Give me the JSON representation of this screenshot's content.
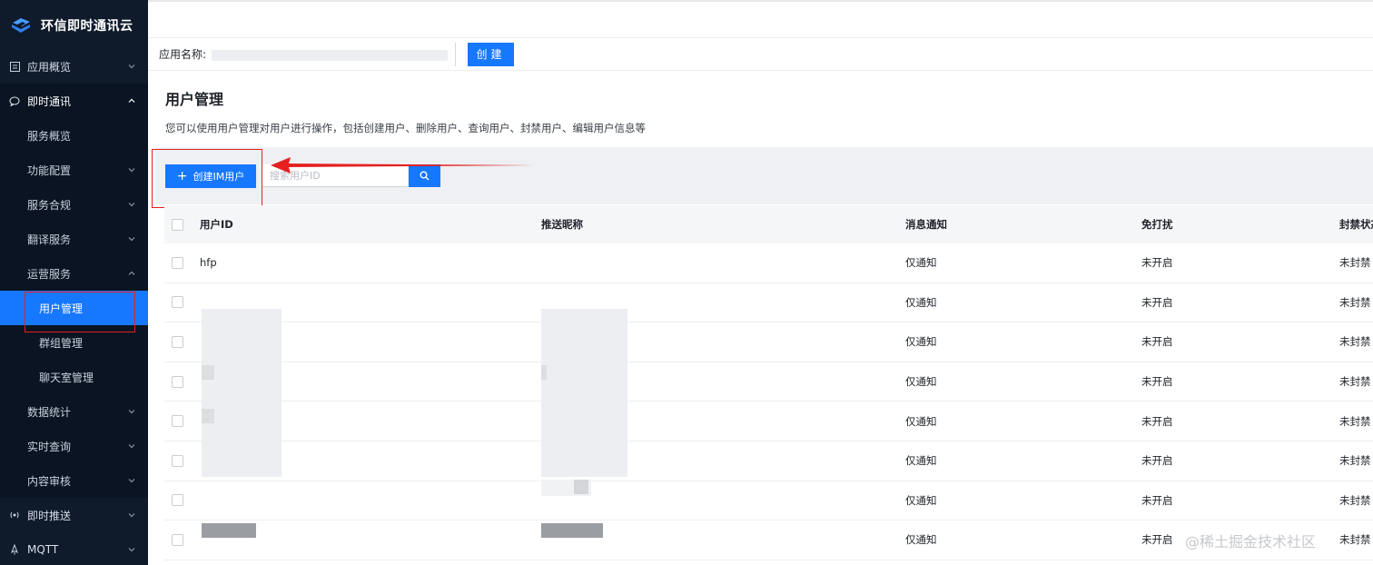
{
  "brand": {
    "name": "环信即时通讯云"
  },
  "sidebar": {
    "items": [
      {
        "label": "应用概览",
        "icon": "overview-icon",
        "level": "top"
      },
      {
        "label": "即时通讯",
        "icon": "chat-icon",
        "level": "top",
        "open": true
      },
      {
        "label": "服务概览",
        "level": "sub"
      },
      {
        "label": "功能配置",
        "level": "sub"
      },
      {
        "label": "服务合规",
        "level": "sub"
      },
      {
        "label": "翻译服务",
        "level": "sub"
      },
      {
        "label": "运营服务",
        "level": "sub",
        "open": true
      },
      {
        "label": "用户管理",
        "level": "leaf",
        "active": true
      },
      {
        "label": "群组管理",
        "level": "leaf"
      },
      {
        "label": "聊天室管理",
        "level": "leaf"
      },
      {
        "label": "数据统计",
        "level": "sub"
      },
      {
        "label": "实时查询",
        "level": "sub"
      },
      {
        "label": "内容审核",
        "level": "sub"
      },
      {
        "label": "即时推送",
        "icon": "push-icon",
        "level": "top"
      },
      {
        "label": "MQTT",
        "icon": "mqtt-icon",
        "level": "top"
      }
    ]
  },
  "appbar": {
    "app_name_label": "应用名称:",
    "create_label": "创建"
  },
  "page": {
    "title": "用户管理",
    "description": "您可以使用用户管理对用户进行操作，包括创建用户、删除用户、查询用户、封禁用户、编辑用户信息等"
  },
  "toolbar": {
    "add_label": "创建IM用户",
    "search_placeholder": "搜索用户ID"
  },
  "table": {
    "columns": [
      "用户ID",
      "推送昵称",
      "消息通知",
      "免打扰",
      "封禁状态"
    ],
    "rows": [
      {
        "id": "hfp",
        "nickname": "",
        "notify": "仅通知",
        "dnd": "未开启",
        "ban": "未封禁"
      },
      {
        "id": "",
        "nickname": "",
        "notify": "仅通知",
        "dnd": "未开启",
        "ban": "未封禁"
      },
      {
        "id": "",
        "nickname": "",
        "notify": "仅通知",
        "dnd": "未开启",
        "ban": "未封禁"
      },
      {
        "id": "",
        "nickname": "",
        "notify": "仅通知",
        "dnd": "未开启",
        "ban": "未封禁"
      },
      {
        "id": "",
        "nickname": "",
        "notify": "仅通知",
        "dnd": "未开启",
        "ban": "未封禁"
      },
      {
        "id": "",
        "nickname": "",
        "notify": "仅通知",
        "dnd": "未开启",
        "ban": "未封禁"
      },
      {
        "id": "",
        "nickname": "",
        "notify": "仅通知",
        "dnd": "未开启",
        "ban": "未封禁"
      },
      {
        "id": "",
        "nickname": "",
        "notify": "仅通知",
        "dnd": "未开启",
        "ban": "未封禁"
      }
    ]
  },
  "watermark": "@稀土掘金技术社区",
  "colors": {
    "sidebar_bg": "#0f1a2b",
    "accent": "#1677ff",
    "highlight": "#e52020"
  }
}
